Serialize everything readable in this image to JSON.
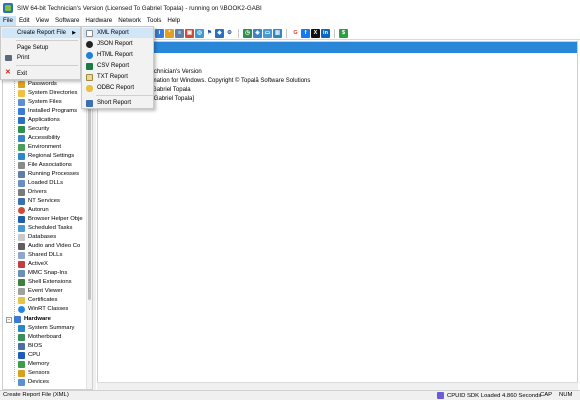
{
  "window": {
    "title": "SIW 64-bit Technician's Version (Licensed To Gabriel Topala) - running on \\\\BOOK2-GABI"
  },
  "menubar": [
    "File",
    "Edit",
    "View",
    "Software",
    "Hardware",
    "Network",
    "Tools",
    "Help"
  ],
  "file_menu": {
    "create_report": "Create Report File",
    "page_setup": "Page Setup",
    "print": "Print",
    "exit": "Exit"
  },
  "report_submenu": [
    "XML Report",
    "JSON Report",
    "HTML Report",
    "CSV Report",
    "TXT Report",
    "ODBC Report",
    "Short Report"
  ],
  "toolbar_icons": [
    "info-icon",
    "passwords-icon",
    "settings-icon",
    "image-icon",
    "scan-icon",
    "flag-icon",
    "network-icon",
    "gear-icon",
    "clock-icon",
    "shield-icon",
    "monitor-icon",
    "chart-icon",
    "google-icon",
    "facebook-icon",
    "x-icon",
    "linkedin-icon",
    "dollar-icon"
  ],
  "tree": {
    "software_items": [
      "Passwords",
      "System Directories",
      "System Files",
      "Installed Programs",
      "Applications",
      "Security",
      "Accessibility",
      "Environment",
      "Regional Settings",
      "File Associations",
      "Running Processes",
      "Loaded DLLs",
      "Drivers",
      "NT Services",
      "Autorun",
      "Browser Helper Obje",
      "Scheduled Tasks",
      "Databases",
      "Audio and Video Co",
      "Shared DLLs",
      "ActiveX",
      "MMC Snap-Ins",
      "Shell Extensions",
      "Event Viewer",
      "Certificates",
      "WinRT Classes"
    ],
    "hardware_label": "Hardware",
    "hardware_items": [
      "System Summary",
      "Motherboard",
      "BIOS",
      "CPU",
      "Memory",
      "Sensors",
      "Devices"
    ]
  },
  "main": {
    "lines": [
      "SIW 64-bit Technician's Version",
      "System Information for Windows. Copyright © Topală Software Solutions",
      "Licensed to: Gabriel Topala",
      "gabi@gtopa [Gabriel Topala]"
    ]
  },
  "statusbar": {
    "left": "Create Report File (XML)",
    "sdk": "CPUID SDK Loaded 4.860 Seconds",
    "cap": "CAP",
    "num": "NUM"
  },
  "colors": {
    "accent": "#2a87d8",
    "menu_highlight": "#d1e6f7"
  }
}
